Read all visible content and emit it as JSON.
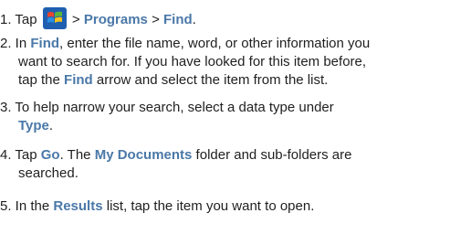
{
  "steps": [
    {
      "s1_a": "1. Tap ",
      "icon": "windows-start-icon",
      "s1_sep1": " > ",
      "s1_programs": "Programs",
      "s1_sep2": " > ",
      "s1_find": "Find",
      "s1_end": "."
    }
  ],
  "step2": {
    "a": "2. In ",
    "find": "Find",
    "b": ", enter the file name, word, or other information you",
    "l2": "want to search for. If you have looked for this item before,",
    "l3a": "tap the ",
    "find2": "Find",
    "l3b": " arrow and select the item from the list."
  },
  "step3": {
    "l1": "3. To help narrow your search, select a data type under",
    "type": "Type",
    "end": "."
  },
  "step4": {
    "a": "4. Tap ",
    "go": "Go",
    "b": ". The ",
    "mydocs": "My Documents",
    "c": " folder and sub-folders are",
    "l2": "searched."
  },
  "step5": {
    "a": "5. In the ",
    "results": "Results",
    "b": " list, tap the item you want to open."
  },
  "colors": {
    "keyword": "#4a78a8",
    "text": "#1f1f1f"
  }
}
